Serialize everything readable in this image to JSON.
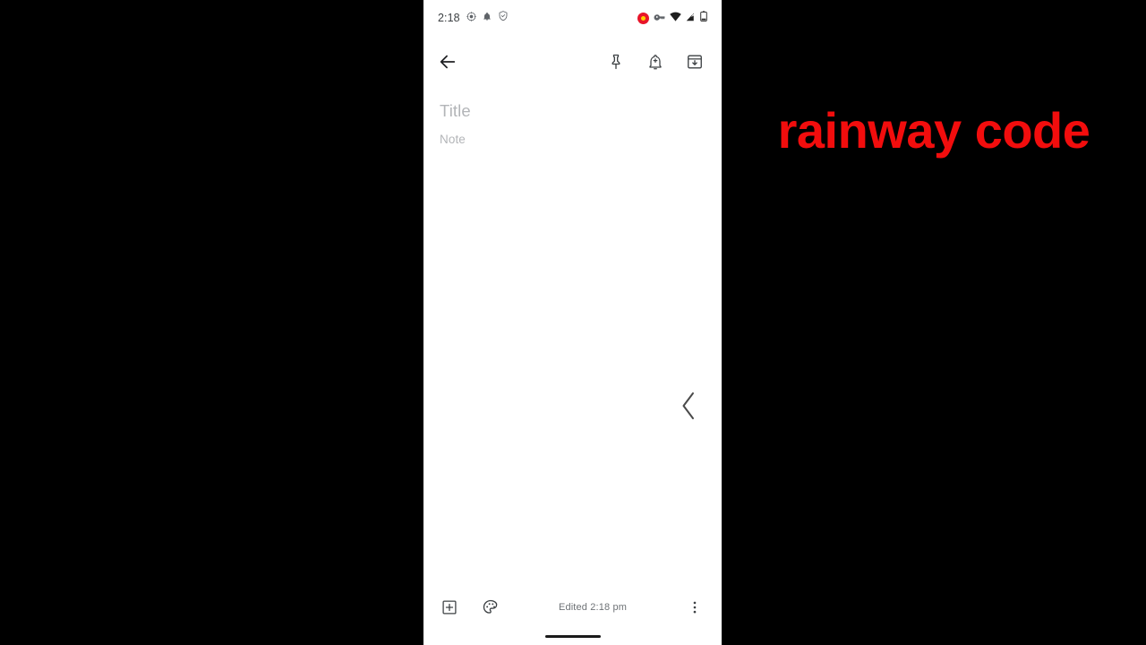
{
  "overlay": {
    "caption_text": "rainway code",
    "caption_color": "#f20d0d",
    "background_color": "#000000"
  },
  "phone": {
    "screen_background": "#ffffff",
    "status_bar": {
      "time": "2:18",
      "left_icons": [
        {
          "name": "circle-dot-icon",
          "label": "circle-dot"
        },
        {
          "name": "notification-bell-icon",
          "label": "bell"
        },
        {
          "name": "shield-icon",
          "label": "shield"
        }
      ],
      "right_icons": [
        {
          "name": "screen-recording-icon",
          "label": "recording",
          "color": "#e8152a"
        },
        {
          "name": "vpn-key-icon",
          "label": "vpn-key"
        },
        {
          "name": "wifi-icon",
          "label": "wifi"
        },
        {
          "name": "cellular-signal-off-icon",
          "label": "cellular-no-sim"
        },
        {
          "name": "battery-icon",
          "label": "battery"
        }
      ]
    },
    "app_bar": {
      "back_label": "Back",
      "actions": [
        {
          "name": "pin-icon",
          "label": "Pin"
        },
        {
          "name": "reminder-icon",
          "label": "Reminder"
        },
        {
          "name": "archive-icon",
          "label": "Archive"
        }
      ]
    },
    "editor": {
      "title_placeholder": "Title",
      "title_value": "",
      "note_placeholder": "Note",
      "note_value": ""
    },
    "edge_gesture": {
      "name": "chevron-left-icon",
      "label": "Back gesture"
    },
    "bottom_bar": {
      "add_label": "Add",
      "palette_label": "Background options",
      "status_text": "Edited 2:18 pm",
      "more_label": "More options"
    },
    "home_indicator": {
      "label": "Home gesture bar",
      "color": "#1a1a1a"
    }
  }
}
